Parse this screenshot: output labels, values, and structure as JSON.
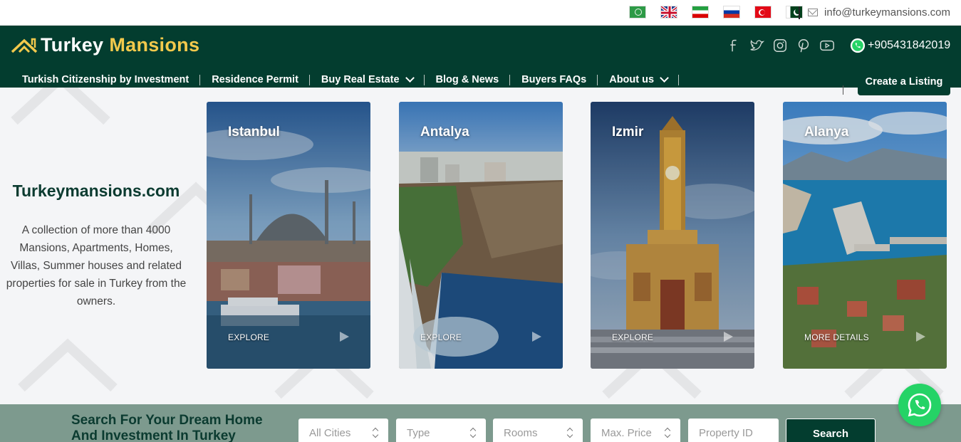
{
  "topbar": {
    "flags": [
      "arabic-flag",
      "uk-flag",
      "iran-flag",
      "russia-flag",
      "turkey-flag",
      "pakistan-flag"
    ],
    "email": "info@turkeymansions.com"
  },
  "header": {
    "logo_word1": "Turkey",
    "logo_word2": "Mansions",
    "phone": "+905431842019",
    "social_icons": [
      "facebook-icon",
      "twitter-icon",
      "instagram-icon",
      "pinterest-icon",
      "youtube-icon"
    ],
    "nav": [
      {
        "label": "Turkish Citizenship by Investment",
        "dropdown": false
      },
      {
        "label": "Residence Permit",
        "dropdown": false
      },
      {
        "label": "Buy Real Estate",
        "dropdown": true
      },
      {
        "label": "Blog & News",
        "dropdown": false
      },
      {
        "label": "Buyers FAQs",
        "dropdown": false
      },
      {
        "label": "About us",
        "dropdown": true
      }
    ],
    "create_listing": "Create a Listing"
  },
  "intro": {
    "title": "Turkeymansions.com",
    "text": "A collection of more than 4000 Mansions, Apartments, Homes, Villas, Summer houses and related properties for sale in Turkey from the owners."
  },
  "cards": [
    {
      "title": "Istanbul",
      "action": "EXPLORE"
    },
    {
      "title": "Antalya",
      "action": "EXPLORE"
    },
    {
      "title": "Izmir",
      "action": "EXPLORE"
    },
    {
      "title": "Alanya",
      "action": "MORE DETAILS"
    }
  ],
  "search": {
    "heading": "Search For Your Dream Home And Investment In Turkey",
    "fields": {
      "city": "All Cities",
      "type": "Type",
      "rooms": "Rooms",
      "max_price": "Max. Price",
      "property_id": "Property ID"
    },
    "button": "Search"
  },
  "colors": {
    "brand_green": "#033d2f",
    "accent_yellow": "#f2c94c",
    "search_strip": "#7d9a8e",
    "whatsapp": "#25d366"
  }
}
